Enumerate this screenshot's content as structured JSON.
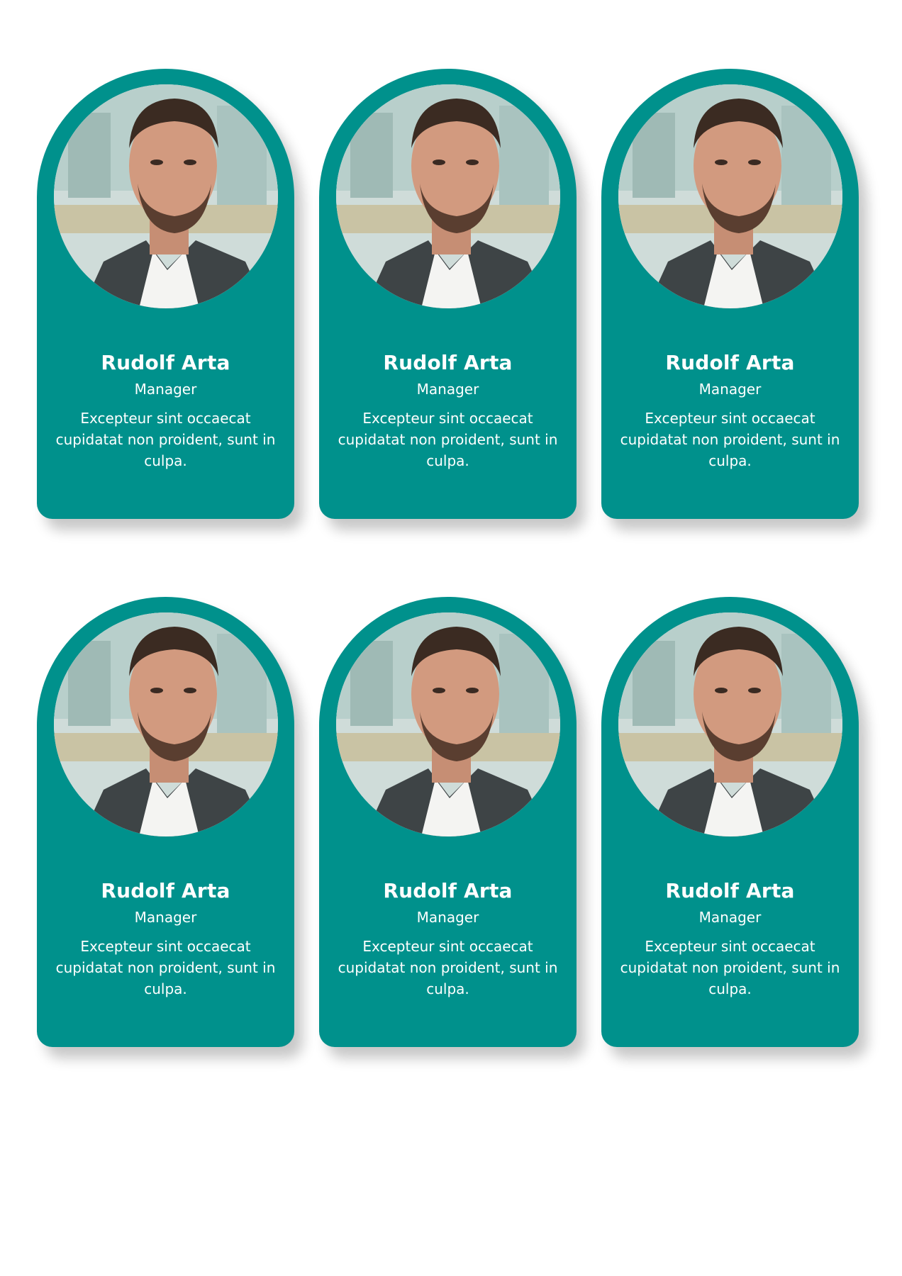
{
  "colors": {
    "card_background": "#00918c",
    "text": "#ffffff",
    "page_background": "#ffffff"
  },
  "cards": [
    {
      "name": "Rudolf Arta",
      "role": "Manager",
      "description": "Excepteur sint occaecat cupidatat non proident, sunt in culpa.",
      "photo": "portrait-man-dark-jacket"
    },
    {
      "name": "Rudolf Arta",
      "role": "Manager",
      "description": "Excepteur sint occaecat cupidatat non proident, sunt in culpa.",
      "photo": "portrait-man-dark-jacket"
    },
    {
      "name": "Rudolf Arta",
      "role": "Manager",
      "description": "Excepteur sint occaecat cupidatat non proident, sunt in culpa.",
      "photo": "portrait-man-dark-jacket"
    },
    {
      "name": "Rudolf Arta",
      "role": "Manager",
      "description": "Excepteur sint occaecat cupidatat non proident, sunt in culpa.",
      "photo": "portrait-man-dark-jacket"
    },
    {
      "name": "Rudolf Arta",
      "role": "Manager",
      "description": "Excepteur sint occaecat cupidatat non proident, sunt in culpa.",
      "photo": "portrait-man-dark-jacket"
    },
    {
      "name": "Rudolf Arta",
      "role": "Manager",
      "description": "Excepteur sint occaecat cupidatat non proident, sunt in culpa.",
      "photo": "portrait-man-dark-jacket"
    }
  ]
}
